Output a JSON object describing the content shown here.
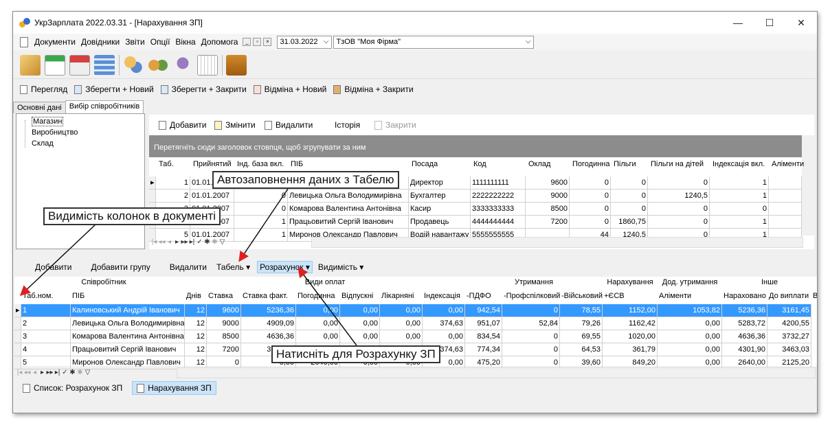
{
  "window": {
    "title": "УкрЗарплата 2022.03.31 - [Нарахування ЗП]",
    "min": "—",
    "max": "☐",
    "close": "✕"
  },
  "menu": {
    "items": [
      "Документи",
      "Довідники",
      "Звіти",
      "Опції",
      "Вікна",
      "Допомога"
    ],
    "date": "31.03.2022",
    "company": "ТзОВ \"Моя Фірма\""
  },
  "toolbar2": {
    "view": "Перегляд",
    "save_new": "Зберегти + Новий",
    "save_close": "Зберегти + Закрити",
    "cancel_new": "Відміна + Новий",
    "cancel_close": "Відміна + Закрити"
  },
  "tabs": {
    "main": "Основні дані",
    "select": "Вибір співробітників"
  },
  "tree": {
    "items": [
      "Магазин",
      "Виробництво",
      "Склад"
    ]
  },
  "emp_toolbar": {
    "add": "Добавити",
    "edit": "Змінити",
    "delete": "Видалити",
    "history": "Історія",
    "close": "Закрити"
  },
  "emp_grid": {
    "group_hint": "Перетягніть сюди заголовок стовпця, щоб згрупувати за ним",
    "headers": [
      "Таб.",
      "Прийнятий",
      "Інд. база вкл.",
      "ПІБ",
      "Посада",
      "Код",
      "Оклад",
      "Погодинна",
      "Пільги",
      "Пільги на дітей",
      "Індексація вкл.",
      "Аліменти"
    ],
    "rows": [
      [
        "1",
        "01.01.2007",
        "0",
        "Калиновський Андрій Іванович",
        "Директор",
        "1111111111",
        "9600",
        "0",
        "0",
        "0",
        "1"
      ],
      [
        "2",
        "01.01.2007",
        "0",
        "Левицька Ольга Володимирівна",
        "Бухгалтер",
        "2222222222",
        "9000",
        "0",
        "0",
        "1240,5",
        "1"
      ],
      [
        "3",
        "01.01.2007",
        "0",
        "Комарова Валентина Антонівна",
        "Касир",
        "3333333333",
        "8500",
        "0",
        "0",
        "0",
        "0"
      ],
      [
        "4",
        "01.01.2007",
        "1",
        "Працьовитий Сергій Іванович",
        "Продавець",
        "4444444444",
        "7200",
        "0",
        "1860,75",
        "0",
        "1"
      ],
      [
        "5",
        "01.01.2007",
        "1",
        "Миронов Олександр Павлович",
        "Водій навантажу",
        "5555555555",
        "",
        "44",
        "1240,5",
        "0",
        "1"
      ]
    ]
  },
  "calc_toolbar": {
    "add": "Добавити",
    "add_group": "Добавити групу",
    "delete": "Видалити",
    "timesheet": "Табель",
    "calc": "Розрахунок",
    "visibility": "Видимість"
  },
  "calc_grid": {
    "groups": [
      "Співробітник",
      "Види оплат",
      "Утримання",
      "Нарахування",
      "Дод. утримання",
      "Інше"
    ],
    "headers": [
      "Таб.ном.",
      "ПІБ",
      "Днів",
      "Ставка",
      "Ставка факт.",
      "Погодинна",
      "Відпускні",
      "Лікарняні",
      "Індексація",
      "-ПДФО",
      "-Профспілковий",
      "-Військовий",
      "+ЄСВ",
      "Аліменти",
      "Нараховано",
      "До виплати",
      "В"
    ],
    "rows": [
      [
        "1",
        "Калиновський Андрій Іванович",
        "12",
        "9600",
        "5236,36",
        "0,00",
        "0,00",
        "0,00",
        "0,00",
        "942,54",
        "0",
        "78,55",
        "1152,00",
        "1053,82",
        "5236,36",
        "3161,45"
      ],
      [
        "2",
        "Левицька Ольга Володимирівна",
        "12",
        "9000",
        "4909,09",
        "0,00",
        "0,00",
        "0,00",
        "374,63",
        "951,07",
        "52,84",
        "79,26",
        "1162,42",
        "0,00",
        "5283,72",
        "4200,55"
      ],
      [
        "3",
        "Комарова Валентина Антонівна",
        "12",
        "8500",
        "4636,36",
        "0,00",
        "0,00",
        "0,00",
        "0,00",
        "834,54",
        "0",
        "69,55",
        "1020,00",
        "0,00",
        "4636,36",
        "3732,27"
      ],
      [
        "4",
        "Працьовитий Сергій Іванович",
        "12",
        "7200",
        "3927,27",
        "0,00",
        "0,00",
        "0,00",
        "374,63",
        "774,34",
        "0",
        "64,53",
        "361,79",
        "0,00",
        "4301,90",
        "3463,03"
      ],
      [
        "5",
        "Миронов Олександр Павлович",
        "12",
        "0",
        "0,00",
        "2640,00",
        "0,00",
        "0,00",
        "0,00",
        "475,20",
        "0",
        "39,60",
        "849,20",
        "0,00",
        "2640,00",
        "2125,20"
      ]
    ]
  },
  "bottom_tabs": {
    "list": "Список: Розрахунок ЗП",
    "calc": "Нарахування ЗП"
  },
  "callouts": {
    "autofill": "Автозаповнення даних з Табелю",
    "visibility": "Видимість колонок в документі",
    "calculate": "Натисніть для Розрахунку ЗП"
  }
}
